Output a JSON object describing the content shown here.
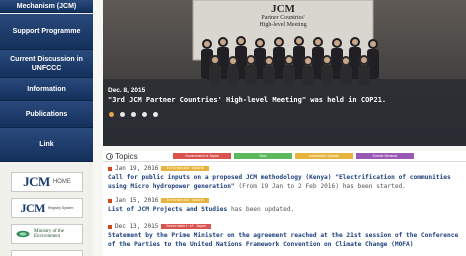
{
  "sidebar": {
    "top_partial": "Mechanism (JCM)",
    "items": [
      {
        "label": "Support Programme"
      },
      {
        "label": "Current Discussion in UNFCCC"
      },
      {
        "label": "Information"
      },
      {
        "label": "Publications"
      },
      {
        "label": "Link"
      }
    ],
    "logos": [
      {
        "mark": "JCM",
        "sub": "HOME"
      },
      {
        "mark": "JCM",
        "sub": "Registry System"
      },
      {
        "mark": "Ministry of the Environment",
        "sub": ""
      }
    ]
  },
  "slideshow": {
    "sign_lines": [
      "JCM",
      "Partner Countries'",
      "High-level Meeting"
    ],
    "date": "Dec. 8, 2015",
    "title": "\"3rd JCM Partner Countries' High-level Meeting\" was held in COP21.",
    "dots": 5,
    "active_dot": 0
  },
  "topics": {
    "heading": "Topics",
    "tabs": [
      {
        "label": "Government of Japan",
        "color": "#d9534f"
      },
      {
        "label": "New",
        "color": "#5cb85c"
      },
      {
        "label": "Information Update",
        "color": "#e6b43c"
      },
      {
        "label": "Events Seminar",
        "color": "#9b59b6"
      }
    ],
    "items": [
      {
        "date": "Jan 19, 2016",
        "badge": "Information Update",
        "badge_color": "#e6b43c",
        "text": "Call for public inputs on a proposed JCM methodology (Kenya) \"Electrification of communities using Micro hydropower generation\"",
        "extra": " (From 19 Jan to 2 Feb 2016) has been started."
      },
      {
        "date": "Jan 15, 2016",
        "badge": "Information Update",
        "badge_color": "#e6b43c",
        "text": "List of JCM Projects and Studies",
        "extra": " has been updated."
      },
      {
        "date": "Dec 13, 2015",
        "badge": "Government of Japan",
        "badge_color": "#d9534f",
        "text": "Statement by the Prime Minister on the agreement reached at the 21st session of the Conference of the Parties to the United Nations Framework Convention on Climate Change (MOFA)",
        "extra": ""
      }
    ]
  }
}
